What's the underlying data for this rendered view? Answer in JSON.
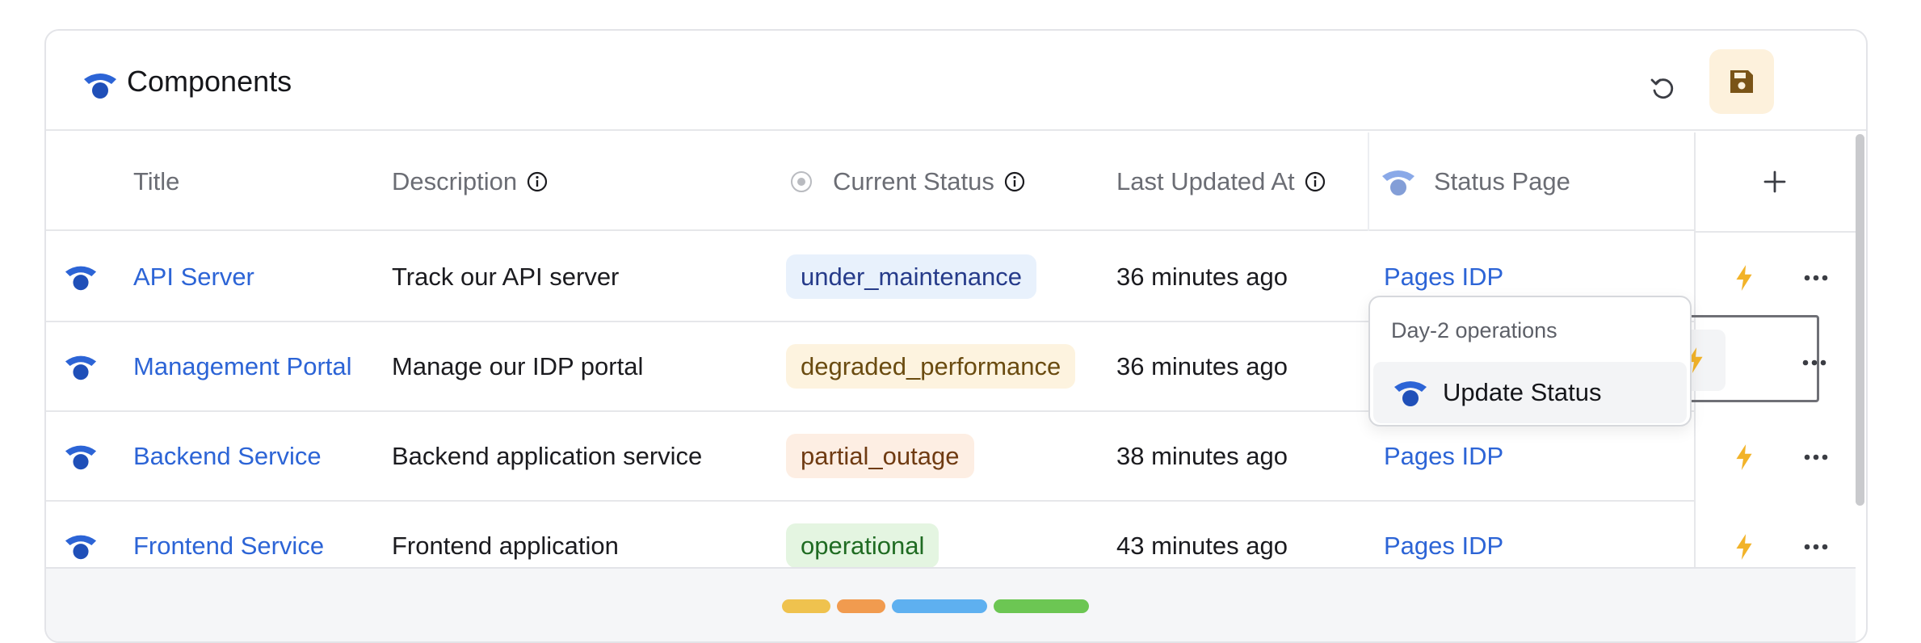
{
  "header": {
    "title": "Components"
  },
  "columns": {
    "title": "Title",
    "description": "Description",
    "current_status": "Current Status",
    "last_updated": "Last Updated At",
    "status_page": "Status Page"
  },
  "rows": [
    {
      "title": "API Server",
      "description": "Track our API server",
      "status": "under_maintenance",
      "updated": "36 minutes ago",
      "page": "Pages IDP"
    },
    {
      "title": "Management Portal",
      "description": "Manage our IDP portal",
      "status": "degraded_performance",
      "updated": "36 minutes ago",
      "page": ""
    },
    {
      "title": "Backend Service",
      "description": "Backend application service",
      "status": "partial_outage",
      "updated": "38 minutes ago",
      "page": "Pages IDP"
    },
    {
      "title": "Frontend Service",
      "description": "Frontend application",
      "status": "operational",
      "updated": "43 minutes ago",
      "page": "Pages IDP"
    }
  ],
  "dropdown": {
    "heading": "Day-2 operations",
    "item": "Update Status"
  },
  "colors": {
    "accent": "#2c64d6",
    "bolt": "#f2b329",
    "save_icon": "#7a5417",
    "legend": [
      "#efc24e",
      "#f19b4f",
      "#5eb0f0",
      "#6cc653"
    ]
  },
  "icons": [
    "components-icon",
    "reset-icon",
    "save-icon",
    "info-icon",
    "status-dot-icon",
    "plus-icon",
    "bolt-icon",
    "more-icon"
  ]
}
